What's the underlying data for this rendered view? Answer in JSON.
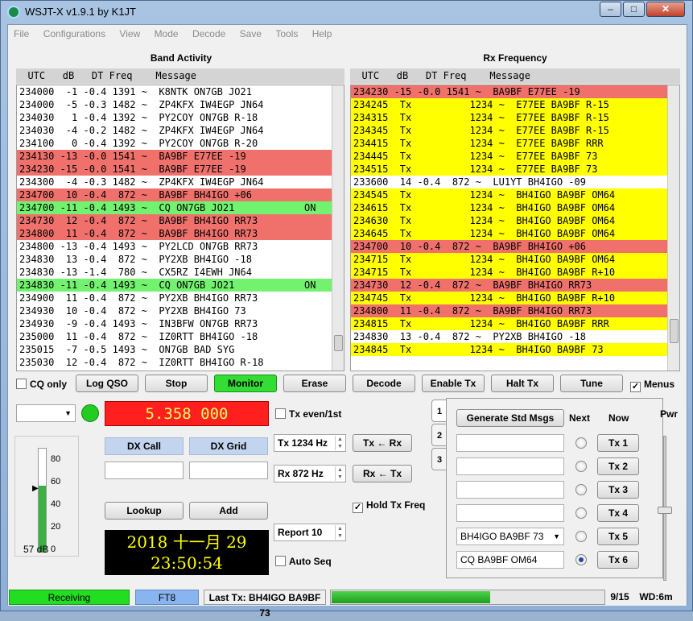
{
  "window": {
    "title": "WSJT-X   v1.9.1   by K1JT"
  },
  "menu": [
    "File",
    "Configurations",
    "View",
    "Mode",
    "Decode",
    "Save",
    "Tools",
    "Help"
  ],
  "band_activity": {
    "title": "Band Activity",
    "columns": "  UTC   dB   DT Freq    Message",
    "rows": [
      {
        "text": "234000  -1 -0.4 1391 ~  K8NTK ON7GB JO21",
        "hl": ""
      },
      {
        "text": "234000  -5 -0.3 1482 ~  ZP4KFX IW4EGP JN64",
        "hl": ""
      },
      {
        "text": "234030   1 -0.4 1392 ~  PY2COY ON7GB R-18",
        "hl": ""
      },
      {
        "text": "234030  -4 -0.2 1482 ~  ZP4KFX IW4EGP JN64",
        "hl": ""
      },
      {
        "text": "234100   0 -0.4 1392 ~  PY2COY ON7GB R-20",
        "hl": ""
      },
      {
        "text": "234130 -13 -0.0 1541 ~  BA9BF E77EE -19",
        "hl": "red"
      },
      {
        "text": "234230 -15 -0.0 1541 ~  BA9BF E77EE -19",
        "hl": "red"
      },
      {
        "text": "234300  -4 -0.3 1482 ~  ZP4KFX IW4EGP JN64",
        "hl": ""
      },
      {
        "text": "234700  10 -0.4  872 ~  BA9BF BH4IGO +06",
        "hl": "red"
      },
      {
        "text": "234700 -11 -0.4 1493 ~  CQ ON7GB JO21            ON",
        "hl": "green"
      },
      {
        "text": "234730  12 -0.4  872 ~  BA9BF BH4IGO RR73",
        "hl": "red"
      },
      {
        "text": "234800  11 -0.4  872 ~  BA9BF BH4IGO RR73",
        "hl": "red"
      },
      {
        "text": "234800 -13 -0.4 1493 ~  PY2LCD ON7GB RR73",
        "hl": ""
      },
      {
        "text": "234830  13 -0.4  872 ~  PY2XB BH4IGO -18",
        "hl": ""
      },
      {
        "text": "234830 -13 -1.4  780 ~  CX5RZ I4EWH JN64",
        "hl": ""
      },
      {
        "text": "234830 -11 -0.4 1493 ~  CQ ON7GB JO21            ON",
        "hl": "green"
      },
      {
        "text": "234900  11 -0.4  872 ~  PY2XB BH4IGO RR73",
        "hl": ""
      },
      {
        "text": "234930  10 -0.4  872 ~  PY2XB BH4IGO 73",
        "hl": ""
      },
      {
        "text": "234930  -9 -0.4 1493 ~  IN3BFW ON7GB RR73",
        "hl": ""
      },
      {
        "text": "235000  11 -0.4  872 ~  IZ0RTT BH4IGO -18",
        "hl": ""
      },
      {
        "text": "235015  -7 -0.5 1493 ~  ON7GB BAD SYG",
        "hl": ""
      },
      {
        "text": "235030  12 -0.4  872 ~  IZ0RTT BH4IGO R-18",
        "hl": ""
      }
    ]
  },
  "rx_frequency": {
    "title": "Rx Frequency",
    "columns": "  UTC   dB   DT Freq    Message",
    "rows": [
      {
        "text": "234230 -15 -0.0 1541 ~  BA9BF E77EE -19",
        "hl": "red"
      },
      {
        "text": "234245  Tx          1234 ~  E77EE BA9BF R-15",
        "hl": "yellow"
      },
      {
        "text": "234315  Tx          1234 ~  E77EE BA9BF R-15",
        "hl": "yellow"
      },
      {
        "text": "234345  Tx          1234 ~  E77EE BA9BF R-15",
        "hl": "yellow"
      },
      {
        "text": "234415  Tx          1234 ~  E77EE BA9BF RRR",
        "hl": "yellow"
      },
      {
        "text": "234445  Tx          1234 ~  E77EE BA9BF 73",
        "hl": "yellow"
      },
      {
        "text": "234515  Tx          1234 ~  E77EE BA9BF 73",
        "hl": "yellow"
      },
      {
        "text": "233600  14 -0.4  872 ~  LU1YT BH4IGO -09",
        "hl": ""
      },
      {
        "text": "234545  Tx          1234 ~  BH4IGO BA9BF OM64",
        "hl": "yellow"
      },
      {
        "text": "234615  Tx          1234 ~  BH4IGO BA9BF OM64",
        "hl": "yellow"
      },
      {
        "text": "234630  Tx          1234 ~  BH4IGO BA9BF OM64",
        "hl": "yellow"
      },
      {
        "text": "234645  Tx          1234 ~  BH4IGO BA9BF OM64",
        "hl": "yellow"
      },
      {
        "text": "234700  10 -0.4  872 ~  BA9BF BH4IGO +06",
        "hl": "red"
      },
      {
        "text": "234715  Tx          1234 ~  BH4IGO BA9BF OM64",
        "hl": "yellow"
      },
      {
        "text": "234715  Tx          1234 ~  BH4IGO BA9BF R+10",
        "hl": "yellow"
      },
      {
        "text": "234730  12 -0.4  872 ~  BA9BF BH4IGO RR73",
        "hl": "red"
      },
      {
        "text": "234745  Tx          1234 ~  BH4IGO BA9BF R+10",
        "hl": "yellow"
      },
      {
        "text": "234800  11 -0.4  872 ~  BA9BF BH4IGO RR73",
        "hl": "red"
      },
      {
        "text": "234815  Tx          1234 ~  BH4IGO BA9BF RRR",
        "hl": "yellow"
      },
      {
        "text": "234830  13 -0.4  872 ~  PY2XB BH4IGO -18",
        "hl": ""
      },
      {
        "text": "234845  Tx          1234 ~  BH4IGO BA9BF 73",
        "hl": "yellow"
      }
    ]
  },
  "buttons": {
    "cq_only": "CQ only",
    "log_qso": "Log QSO",
    "stop": "Stop",
    "monitor": "Monitor",
    "erase": "Erase",
    "decode": "Decode",
    "enable_tx": "Enable Tx",
    "halt_tx": "Halt Tx",
    "tune": "Tune",
    "menus": "Menus",
    "dx_call": "DX Call",
    "dx_grid": "DX Grid",
    "lookup": "Lookup",
    "add": "Add",
    "tx_from_rx": "Tx ← Rx",
    "rx_from_tx": "Rx ← Tx",
    "generate": "Generate Std Msgs",
    "next": "Next",
    "now": "Now"
  },
  "freq_display": "5.358  000",
  "clock": {
    "date": "2018 十一月 29",
    "time": "23:50:54"
  },
  "tx_even": "Tx even/1st",
  "tx_freq": "Tx  1234  Hz",
  "rx_freq": "Rx  872  Hz",
  "hold_tx_freq": "Hold Tx Freq",
  "report": "Report 10",
  "auto_seq": "Auto Seq",
  "meter": {
    "ticks": [
      "80",
      "60",
      "40",
      "20",
      "0"
    ],
    "label": "57 dB",
    "level_db": 57
  },
  "tabs": [
    "1",
    "2",
    "3"
  ],
  "tx_messages": [
    {
      "label": "Tx 1",
      "value": ""
    },
    {
      "label": "Tx 2",
      "value": ""
    },
    {
      "label": "Tx 3",
      "value": ""
    },
    {
      "label": "Tx 4",
      "value": ""
    },
    {
      "label": "Tx 5",
      "value": "BH4IGO BA9BF 73"
    },
    {
      "label": "Tx 6",
      "value": "CQ BA9BF OM64"
    }
  ],
  "pwr": "Pwr",
  "status": {
    "receiving": "Receiving",
    "mode": "FT8",
    "last_tx": "Last Tx: BH4IGO BA9BF 73",
    "progress": 0.58,
    "count": "9/15",
    "wd": "WD:6m"
  },
  "colors": {
    "red_row": "#f0716c",
    "green_row": "#72f26e",
    "yellow_row": "#ffff00",
    "monitor": "#33dd33"
  }
}
